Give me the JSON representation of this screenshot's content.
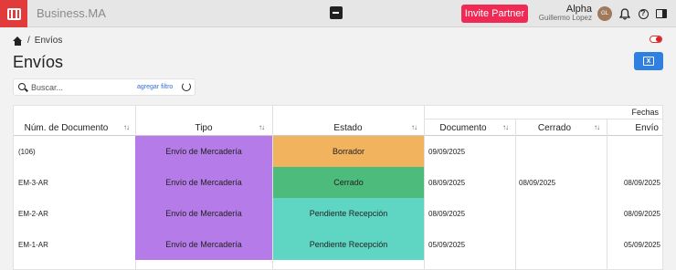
{
  "app": {
    "brand": "Business.MA",
    "invite_label": "Invite Partner",
    "user_name": "Alpha",
    "user_company": "Guillermo Lopez",
    "avatar_initials": "GL"
  },
  "breadcrumb": {
    "current": "Envíos"
  },
  "page": {
    "title": "Envíos"
  },
  "search": {
    "placeholder": "Buscar...",
    "add_filter": "agregar filtro"
  },
  "table": {
    "group_header": "Fechas",
    "columns": {
      "num_doc": "Núm. de Documento",
      "tipo": "Tipo",
      "estado": "Estado",
      "documento": "Documento",
      "cerrado": "Cerrado",
      "envio": "Envío"
    },
    "rows": [
      {
        "num": "(106)",
        "tipo": "Envío de Mercadería",
        "estado": "Borrador",
        "estado_color": "#f2b35f",
        "documento": "09/09/2025",
        "cerrado": "",
        "envio": ""
      },
      {
        "num": "EM-3-AR",
        "tipo": "Envío de Mercadería",
        "estado": "Cerrado",
        "estado_color": "#4dbb7c",
        "documento": "08/09/2025",
        "cerrado": "08/09/2025",
        "envio": "08/09/2025"
      },
      {
        "num": "EM-2-AR",
        "tipo": "Envío de Mercadería",
        "estado": "Pendiente Recepción",
        "estado_color": "#5fd6c3",
        "documento": "08/09/2025",
        "cerrado": "",
        "envio": "08/09/2025"
      },
      {
        "num": "EM-1-AR",
        "tipo": "Envío de Mercadería",
        "estado": "Pendiente Recepción",
        "estado_color": "#5fd6c3",
        "documento": "05/09/2025",
        "cerrado": "",
        "envio": "05/09/2025"
      }
    ],
    "tipo_color": "#b57be8"
  },
  "icons": [
    "briefcase-icon",
    "home-icon",
    "search-icon",
    "refresh-icon",
    "excel-icon",
    "bell-icon",
    "help-icon",
    "panel-icon",
    "sort-icon"
  ]
}
